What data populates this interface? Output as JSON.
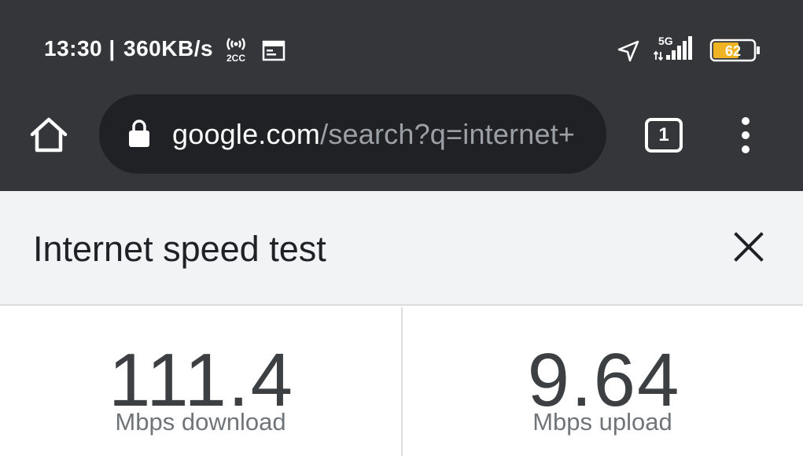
{
  "status_bar": {
    "time": "13:30",
    "net_speed": "360KB/s",
    "network_type": "5G",
    "battery_level": "62",
    "icons": [
      "hotspot-2cc-icon",
      "calendar-icon",
      "location-arrow-icon",
      "signal-icon",
      "battery-icon"
    ],
    "hotspot_label": "2CC"
  },
  "toolbar": {
    "url_domain": "google.com",
    "url_path": "/search?q=internet+",
    "tab_count": "1",
    "icons": [
      "home-icon",
      "lock-icon",
      "more-vert-icon"
    ]
  },
  "panel": {
    "title": "Internet speed test",
    "close_icon": "close-icon"
  },
  "results": {
    "download_value": "111.4",
    "download_label": "Mbps download",
    "upload_value": "9.64",
    "upload_label": "Mbps upload"
  },
  "colors": {
    "toolbar_bg": "#35363a",
    "omnibox_bg": "#202124",
    "battery_fill": "#f0b323",
    "panel_bg": "#f1f3f4"
  }
}
